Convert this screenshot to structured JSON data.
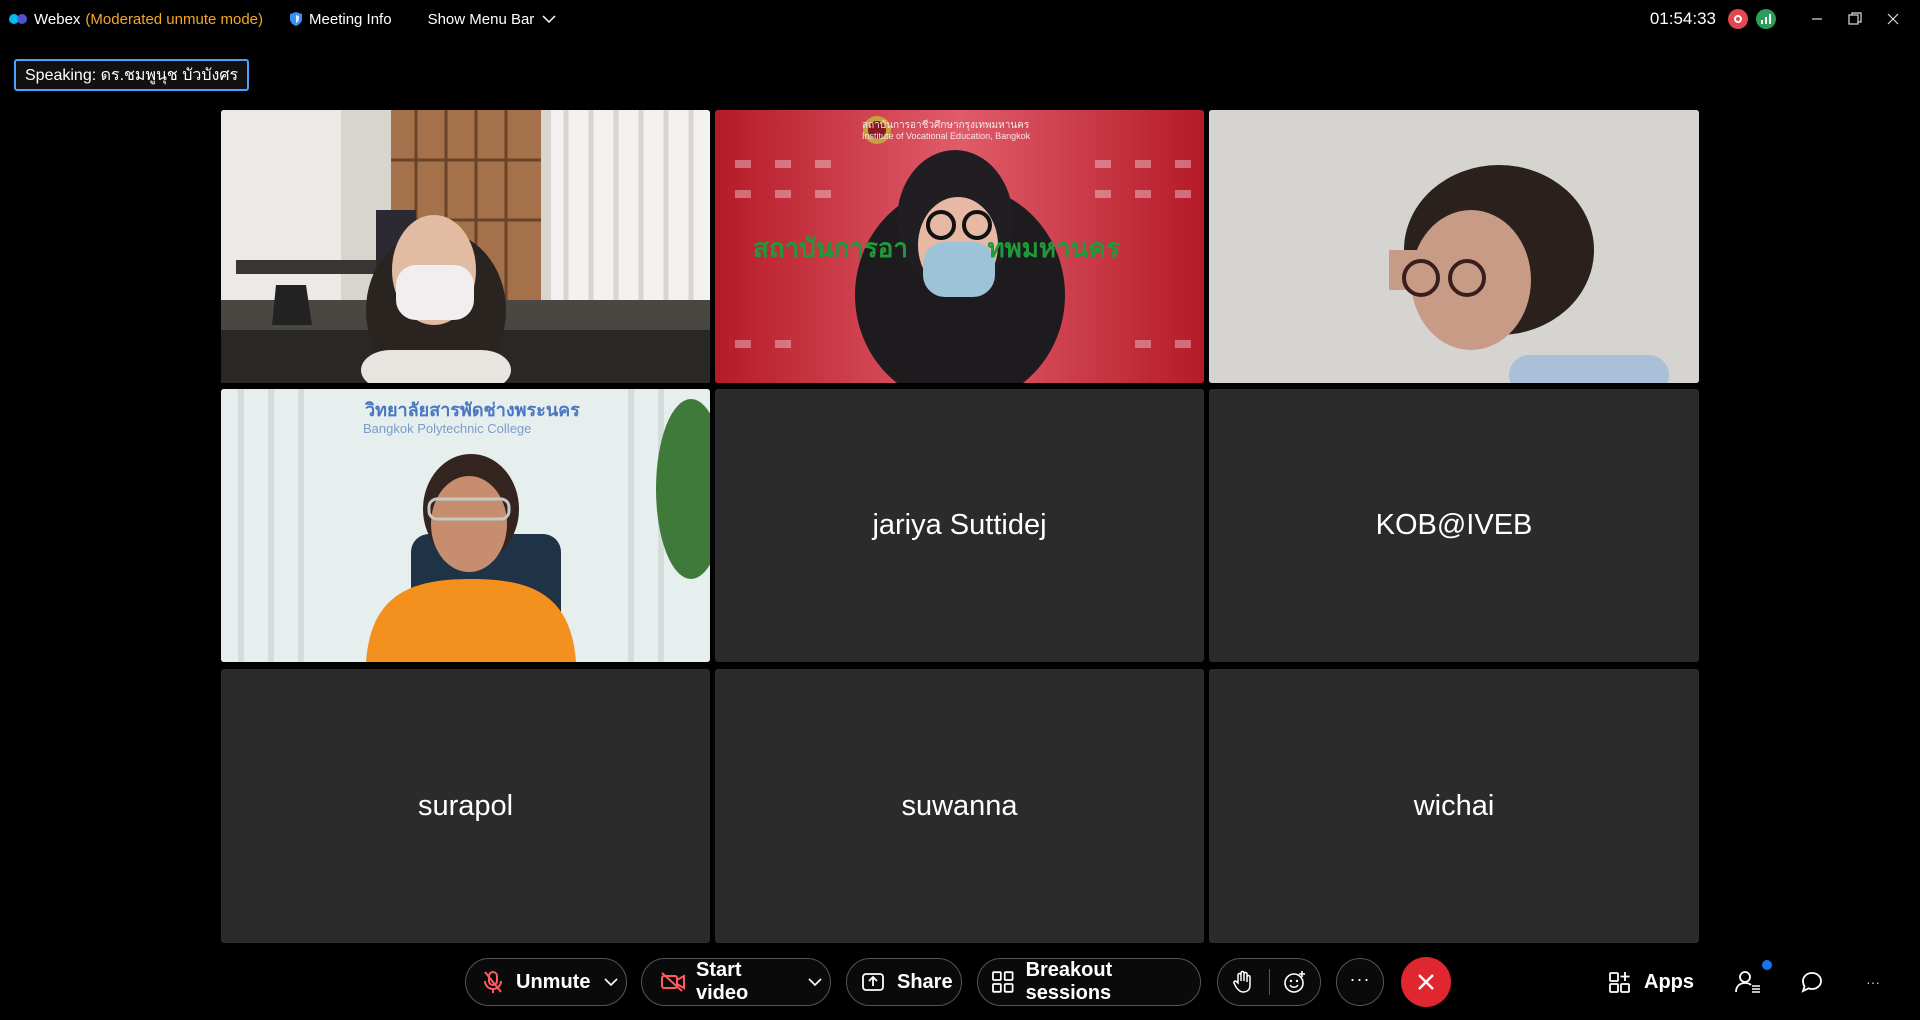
{
  "titlebar": {
    "app_name": "Webex",
    "mode": "(Moderated unmute mode)",
    "meeting_info": "Meeting Info",
    "show_menu": "Show Menu Bar",
    "clock": "01:54:33"
  },
  "speaking_label": "Speaking: ดร.ชมพูนุช บัวบังศร",
  "participants": [
    {
      "name": "",
      "video": true
    },
    {
      "name": "",
      "video": true
    },
    {
      "name": "",
      "video": true
    },
    {
      "name": "",
      "video": true
    },
    {
      "name": "jariya Suttidej",
      "video": false
    },
    {
      "name": "KOB@IVEB",
      "video": false
    },
    {
      "name": "surapol",
      "video": false
    },
    {
      "name": "suwanna",
      "video": false
    },
    {
      "name": "wichai",
      "video": false
    }
  ],
  "video_text": {
    "tile2_banner": "สถาบันการอา           ทพมหานคร",
    "tile2_header": "สถาบันการอาชีวศึกษากรุงเทพมหานคร",
    "tile2_header_en": "Institute of Vocational Education, Bangkok",
    "tile4_header": "วิทยาลัยสารพัดช่างพระนคร",
    "tile4_header_en": "Bangkok Polytechnic College"
  },
  "toolbar": {
    "unmute": "Unmute",
    "start_video": "Start video",
    "share": "Share",
    "breakout": "Breakout sessions",
    "apps": "Apps",
    "more": "···",
    "overflow": "···"
  },
  "colors": {
    "mode": "#f5a623",
    "end_call": "#e0262e",
    "speaking_border": "#4aa3ff",
    "tile_bg": "#2b2b2b"
  }
}
